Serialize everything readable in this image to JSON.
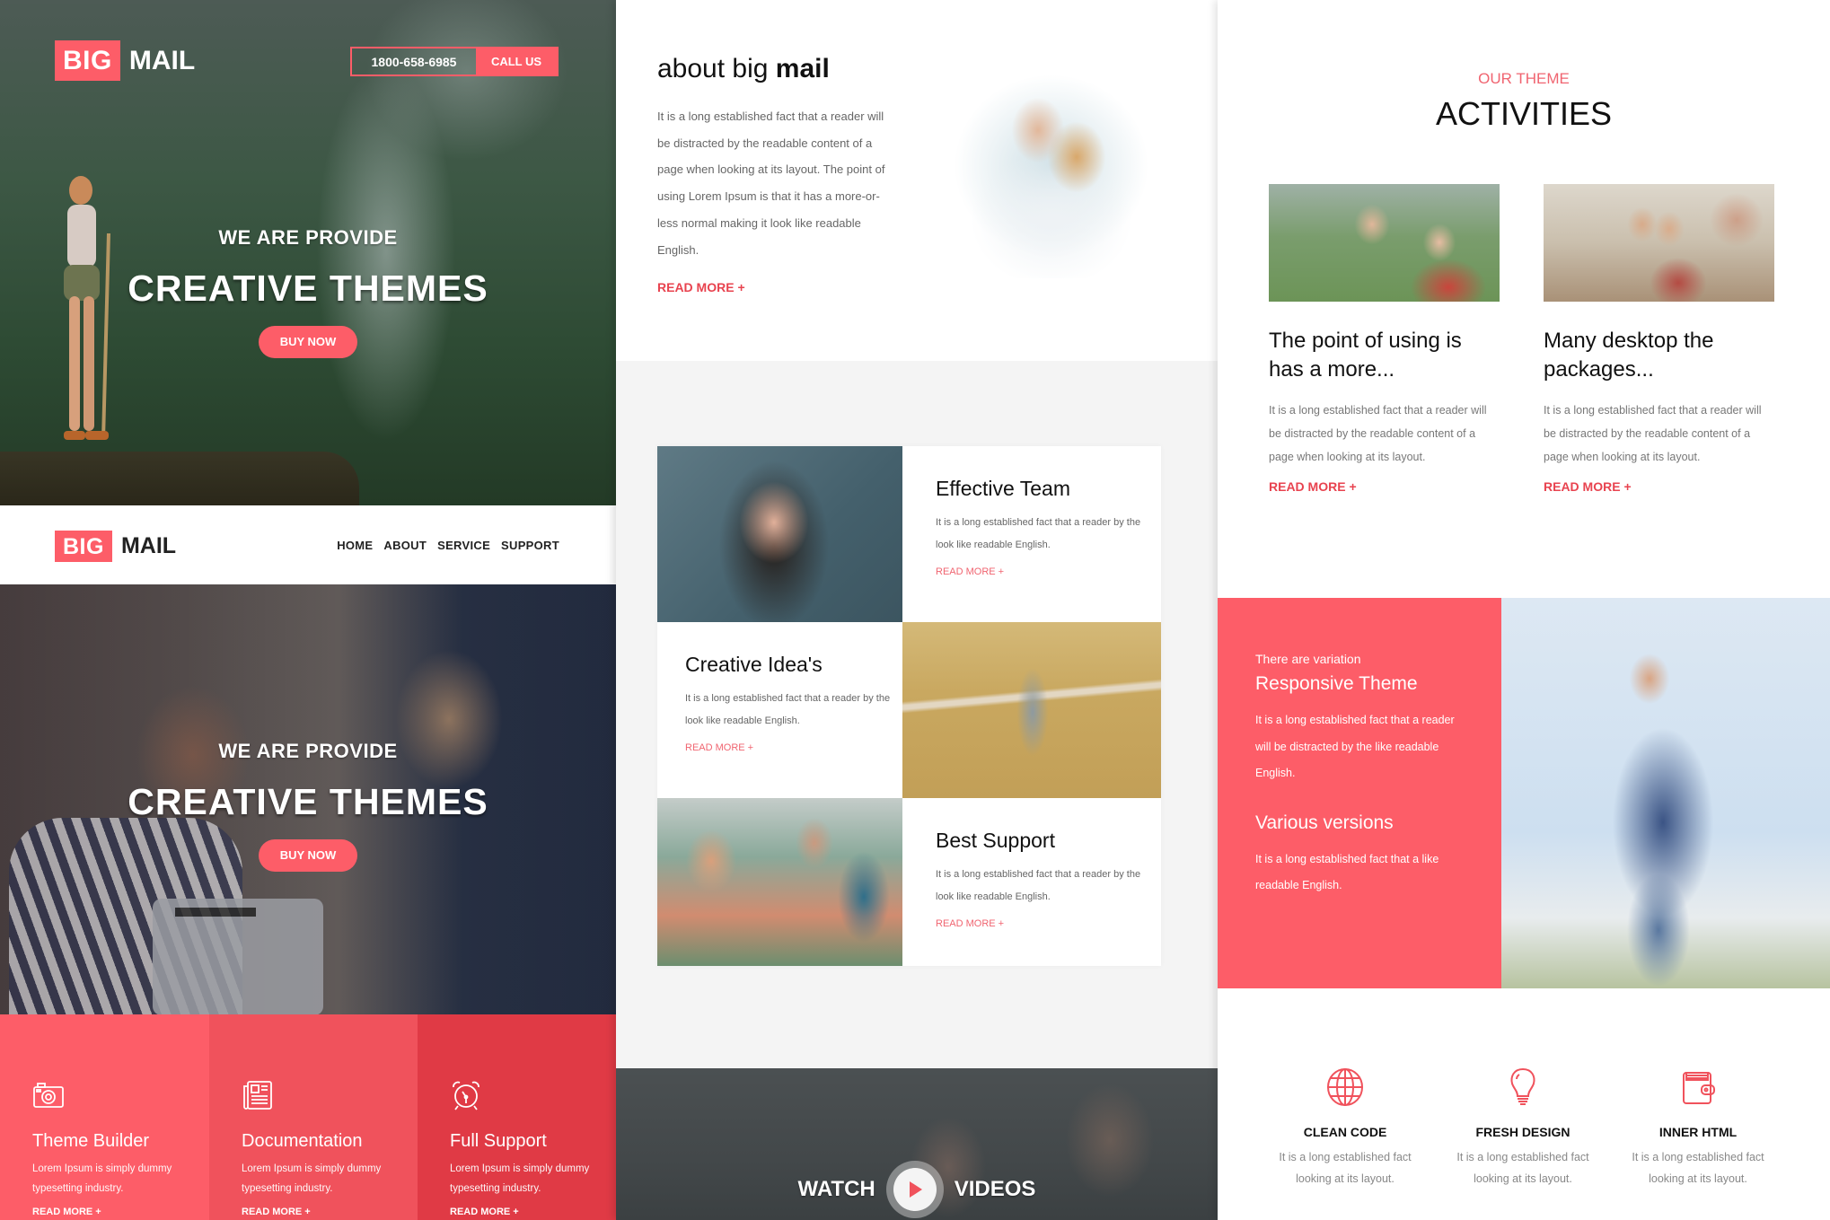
{
  "brand": {
    "logo_box": "BIG",
    "logo_text": "MAIL",
    "accent": "#fd5d68"
  },
  "hero1": {
    "phone": "1800-658-6985",
    "call_label": "CALL US",
    "subtitle": "WE ARE PROVIDE",
    "title": "CREATIVE THEMES",
    "button": "BUY NOW"
  },
  "nav": {
    "items": [
      "HOME",
      "ABOUT",
      "SERVICE",
      "SUPPORT"
    ]
  },
  "hero2": {
    "subtitle": "WE ARE PROVIDE",
    "title": "CREATIVE THEMES",
    "button": "BUY NOW"
  },
  "features_left": [
    {
      "icon": "camera-icon",
      "title": "Theme Builder",
      "desc": "Lorem Ipsum is simply dummy typesetting industry.",
      "more": "READ MORE +"
    },
    {
      "icon": "newspaper-icon",
      "title": "Documentation",
      "desc": "Lorem Ipsum is simply dummy typesetting industry.",
      "more": "READ MORE +"
    },
    {
      "icon": "alarm-clock-icon",
      "title": "Full Support",
      "desc": "Lorem Ipsum is simply dummy typesetting industry.",
      "more": "READ MORE +"
    }
  ],
  "about": {
    "title_light": "about big ",
    "title_bold": "mail",
    "text": "It is a long established fact that a reader will be distracted by the readable content of a page when looking at its layout. The point of using Lorem Ipsum is that it has a more-or-less normal making it look like readable English.",
    "more": "READ MORE +"
  },
  "cards": [
    {
      "title": "Effective Team",
      "text": "It is a long established fact that a reader by the look like readable English.",
      "more": "READ MORE +"
    },
    {
      "title": "Creative Idea's",
      "text": "It is a long established fact that a reader by the look like readable English.",
      "more": "READ MORE +"
    },
    {
      "title": "Best Support",
      "text": "It is a long established fact that a reader by the look like readable English.",
      "more": "READ MORE +"
    }
  ],
  "video": {
    "left": "WATCH",
    "right": "VIDEOS"
  },
  "activities": {
    "kicker": "OUR THEME",
    "title": "ACTIVITIES",
    "items": [
      {
        "title": "The point of using is has a more...",
        "text": "It is a long established fact that a reader will be distracted by the readable content of a page when looking at its layout.",
        "more": "READ MORE +"
      },
      {
        "title": "Many desktop the packages...",
        "text": "It is a long established fact that a reader will be distracted by the readable content of a page when looking at its layout.",
        "more": "READ MORE +"
      }
    ]
  },
  "responsive": {
    "pre": "There are variation",
    "title": "Responsive Theme",
    "text": "It is a long established fact that a reader will be distracted by the like readable English.",
    "title2": "Various versions",
    "text2": "It is a long established fact that a like readable English."
  },
  "icon_features": [
    {
      "icon": "globe-icon",
      "title": "CLEAN CODE",
      "text": "It is a long established fact looking at its layout."
    },
    {
      "icon": "lightbulb-icon",
      "title": "FRESH DESIGN",
      "text": "It is a long established fact looking at its layout."
    },
    {
      "icon": "wallet-icon",
      "title": "INNER HTML",
      "text": "It is a long established fact looking at its layout."
    }
  ]
}
